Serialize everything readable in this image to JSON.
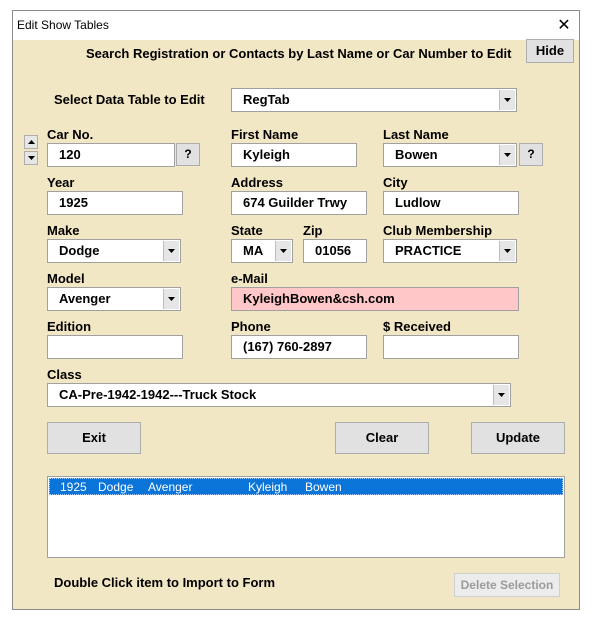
{
  "window": {
    "title": "Edit Show Tables",
    "close_glyph": "✕"
  },
  "header": {
    "search_text": "Search Registration or Contacts by Last Name or Car Number to Edit",
    "hide_button": "Hide"
  },
  "table_select": {
    "label": "Select Data Table to Edit",
    "value": "RegTab"
  },
  "fields": {
    "car_no": {
      "label": "Car No.",
      "value": "120"
    },
    "first_name": {
      "label": "First Name",
      "value": "Kyleigh"
    },
    "last_name": {
      "label": "Last Name",
      "value": "Bowen"
    },
    "year": {
      "label": "Year",
      "value": "1925"
    },
    "address": {
      "label": "Address",
      "value": "674 Guilder Trwy"
    },
    "city": {
      "label": "City",
      "value": "Ludlow"
    },
    "make": {
      "label": "Make",
      "value": "Dodge"
    },
    "state": {
      "label": "State",
      "value": "MA"
    },
    "zip": {
      "label": "Zip",
      "value": "01056"
    },
    "club": {
      "label": "Club Membership",
      "value": "PRACTICE"
    },
    "model": {
      "label": "Model",
      "value": "Avenger"
    },
    "email": {
      "label": "e-Mail",
      "value": "KyleighBowen&csh.com"
    },
    "edition": {
      "label": "Edition",
      "value": ""
    },
    "phone": {
      "label": "Phone",
      "value": "(167) 760-2897"
    },
    "received": {
      "label": "$ Received",
      "value": ""
    },
    "class": {
      "label": "Class",
      "value": "CA-Pre-1942-1942---Truck Stock"
    }
  },
  "query_button": "?",
  "buttons": {
    "exit": "Exit",
    "clear": "Clear",
    "update": "Update",
    "delete_selection": "Delete Selection"
  },
  "list": {
    "rows": [
      {
        "year": "1925",
        "make": "Dodge",
        "model": "Avenger",
        "first": "Kyleigh",
        "last": "Bowen"
      }
    ]
  },
  "footer": {
    "hint": "Double Click item to Import to Form"
  },
  "colors": {
    "form_bg": "#f2e7c4",
    "email_bg": "#ffc7c7",
    "selection": "#0a74d8"
  }
}
